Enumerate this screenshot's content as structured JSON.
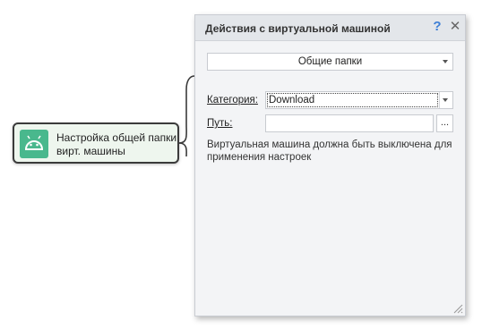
{
  "node": {
    "icon": "android-icon",
    "label": "Настройка общей папки вирт. машины",
    "icon_color": "#49b88d",
    "background": "#eef6ee"
  },
  "dialog": {
    "title": "Действия с виртуальной машиной",
    "help_icon": "?",
    "close_icon": "✕",
    "section_value": "Общие папки",
    "category_label": "Категория:",
    "category_value": "Download",
    "path_label": "Путь:",
    "path_value": "",
    "browse_label": "...",
    "note": "Виртуальная машина должна быть выключена для применения настроек",
    "help_color": "#3d7fd6"
  }
}
